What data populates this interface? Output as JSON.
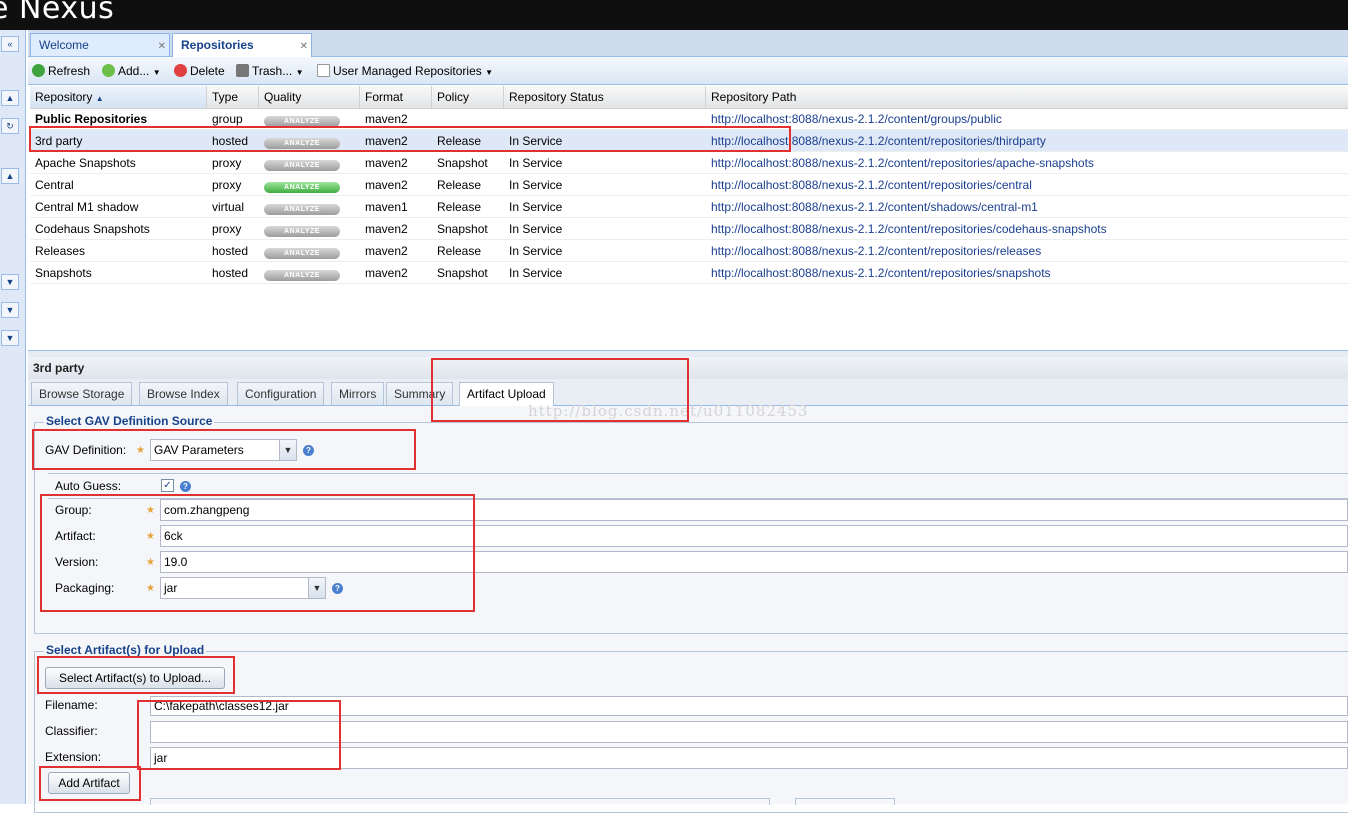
{
  "app": {
    "title": "e Nexus"
  },
  "tabs": [
    {
      "label": "Welcome",
      "active": false
    },
    {
      "label": "Repositories",
      "active": true
    }
  ],
  "toolbar": {
    "refresh": "Refresh",
    "add": "Add...",
    "delete": "Delete",
    "trash": "Trash...",
    "user_managed": "User Managed Repositories"
  },
  "grid": {
    "columns": [
      "Repository",
      "Type",
      "Quality",
      "Format",
      "Policy",
      "Repository Status",
      "Repository Path"
    ],
    "quality_button": "ANALYZE",
    "rows": [
      {
        "name": "Public Repositories",
        "type": "group",
        "format": "maven2",
        "policy": "",
        "status": "",
        "path": "http://localhost:8088/nexus-2.1.2/content/groups/public",
        "bold": true,
        "analyze": "gray"
      },
      {
        "name": "3rd party",
        "type": "hosted",
        "format": "maven2",
        "policy": "Release",
        "status": "In Service",
        "path": "http://localhost:8088/nexus-2.1.2/content/repositories/thirdparty",
        "selected": true,
        "analyze": "gray"
      },
      {
        "name": "Apache Snapshots",
        "type": "proxy",
        "format": "maven2",
        "policy": "Snapshot",
        "status": "In Service",
        "path": "http://localhost:8088/nexus-2.1.2/content/repositories/apache-snapshots",
        "analyze": "gray"
      },
      {
        "name": "Central",
        "type": "proxy",
        "format": "maven2",
        "policy": "Release",
        "status": "In Service",
        "path": "http://localhost:8088/nexus-2.1.2/content/repositories/central",
        "analyze": "green"
      },
      {
        "name": "Central M1 shadow",
        "type": "virtual",
        "format": "maven1",
        "policy": "Release",
        "status": "In Service",
        "path": "http://localhost:8088/nexus-2.1.2/content/shadows/central-m1",
        "analyze": "gray"
      },
      {
        "name": "Codehaus Snapshots",
        "type": "proxy",
        "format": "maven2",
        "policy": "Snapshot",
        "status": "In Service",
        "path": "http://localhost:8088/nexus-2.1.2/content/repositories/codehaus-snapshots",
        "analyze": "gray"
      },
      {
        "name": "Releases",
        "type": "hosted",
        "format": "maven2",
        "policy": "Release",
        "status": "In Service",
        "path": "http://localhost:8088/nexus-2.1.2/content/repositories/releases",
        "analyze": "gray"
      },
      {
        "name": "Snapshots",
        "type": "hosted",
        "format": "maven2",
        "policy": "Snapshot",
        "status": "In Service",
        "path": "http://localhost:8088/nexus-2.1.2/content/repositories/snapshots",
        "analyze": "gray"
      }
    ]
  },
  "detail": {
    "title": "3rd party",
    "tabs": [
      "Browse Storage",
      "Browse Index",
      "Configuration",
      "Mirrors",
      "Summary",
      "Artifact Upload"
    ],
    "active_tab": "Artifact Upload",
    "watermark": "http://blog.csdn.net/u011082453"
  },
  "gav_section": {
    "legend": "Select GAV Definition Source",
    "gav_label": "GAV Definition:",
    "gav_value": "GAV Parameters",
    "auto_guess_label": "Auto Guess:",
    "auto_guess_checked": true,
    "group_label": "Group:",
    "group_value": "com.zhangpeng",
    "artifact_label": "Artifact:",
    "artifact_value": "6ck",
    "version_label": "Version:",
    "version_value": "19.0",
    "packaging_label": "Packaging:",
    "packaging_value": "jar"
  },
  "upload_section": {
    "legend": "Select Artifact(s) for Upload",
    "select_button": "Select Artifact(s) to Upload...",
    "filename_label": "Filename:",
    "filename_value": "C:\\fakepath\\classes12.jar",
    "classifier_label": "Classifier:",
    "classifier_value": "",
    "extension_label": "Extension:",
    "extension_value": "jar",
    "add_button": "Add Artifact"
  },
  "colors": {
    "annotation_red": "#e03030",
    "header_bg": "#0f0f0f",
    "ext_blue": "#15428b"
  }
}
